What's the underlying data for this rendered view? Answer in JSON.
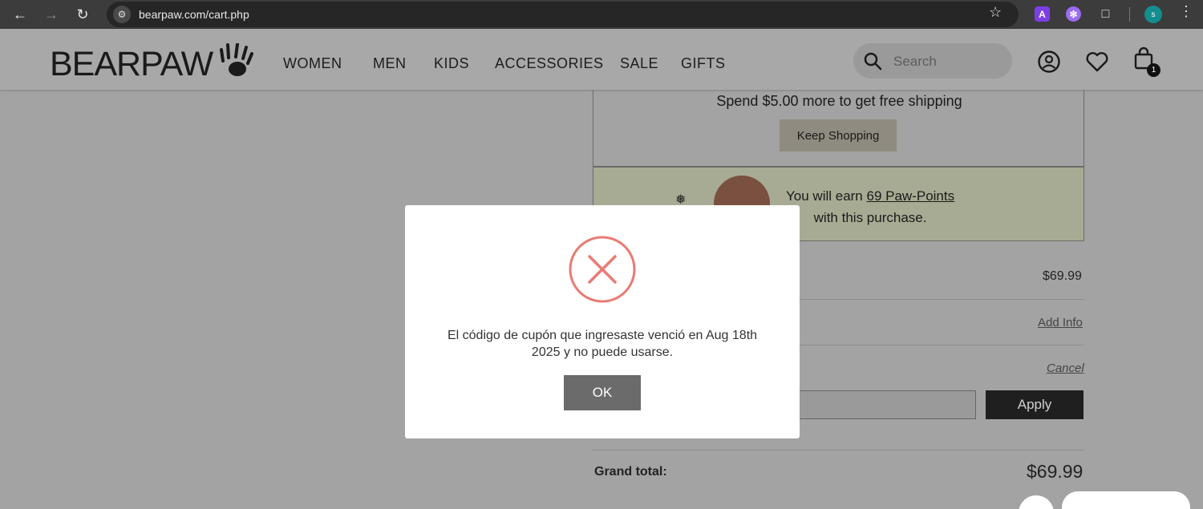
{
  "browser": {
    "url": "bearpaw.com/cart.php",
    "profile_initial": "s",
    "extension_a_label": "A"
  },
  "header": {
    "logo_text": "BEARPAW",
    "nav": [
      "WOMEN",
      "MEN",
      "KIDS",
      "ACCESSORIES",
      "SALE",
      "GIFTS"
    ],
    "search_placeholder": "Search",
    "cart_count": "1"
  },
  "cart": {
    "shipping_message": "Spend $5.00 more to get free shipping",
    "keep_shopping_label": "Keep Shopping",
    "points_prefix": "You will earn ",
    "points_link": "69 Paw-Points",
    "points_suffix": "with this purchase.",
    "subtotal_value": "$69.99",
    "add_info_label": "Add Info",
    "cancel_label": "Cancel",
    "apply_label": "Apply",
    "grand_total_label": "Grand total:",
    "grand_total_value": "$69.99"
  },
  "modal": {
    "message": "El código de cupón que ingresaste venció en Aug 18th 2025 y no puede usarse.",
    "ok_label": "OK",
    "icon": "error-x-circle",
    "icon_color": "#e87b74",
    "ok_color": "#6b6b6b"
  }
}
